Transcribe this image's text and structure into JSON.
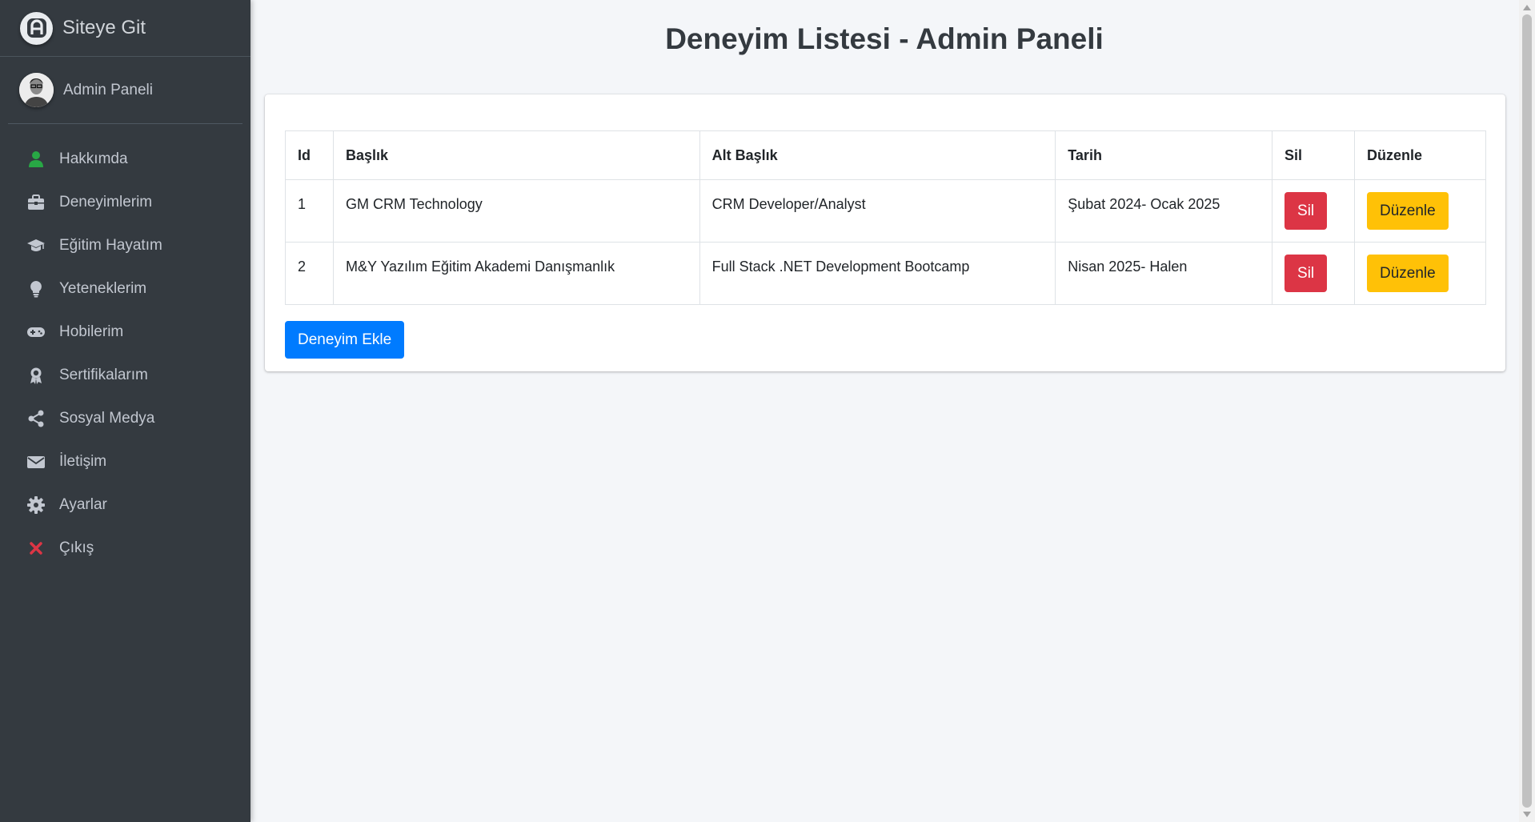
{
  "brand": {
    "logo_icon": "site-logo-icon",
    "text": "Siteye Git"
  },
  "user": {
    "avatar_icon": "user-avatar",
    "name": "Admin Paneli"
  },
  "sidebar": {
    "items": [
      {
        "label": "Hakkımda",
        "icon": "user-icon",
        "icon_color": "#28a745"
      },
      {
        "label": "Deneyimlerim",
        "icon": "briefcase-icon",
        "icon_color": "#c2c7d0"
      },
      {
        "label": "Eğitim Hayatım",
        "icon": "graduation-cap-icon",
        "icon_color": "#c2c7d0"
      },
      {
        "label": "Yeteneklerim",
        "icon": "lightbulb-icon",
        "icon_color": "#c2c7d0"
      },
      {
        "label": "Hobilerim",
        "icon": "gamepad-icon",
        "icon_color": "#c2c7d0"
      },
      {
        "label": "Sertifikalarım",
        "icon": "award-icon",
        "icon_color": "#c2c7d0"
      },
      {
        "label": "Sosyal Medya",
        "icon": "share-icon",
        "icon_color": "#c2c7d0"
      },
      {
        "label": "İletişim",
        "icon": "envelope-icon",
        "icon_color": "#c2c7d0"
      },
      {
        "label": "Ayarlar",
        "icon": "gear-icon",
        "icon_color": "#c2c7d0"
      },
      {
        "label": "Çıkış",
        "icon": "close-icon",
        "icon_color": "#dc3545"
      }
    ]
  },
  "main": {
    "title": "Deneyim Listesi - Admin Paneli",
    "table": {
      "headers": [
        "Id",
        "Başlık",
        "Alt Başlık",
        "Tarih",
        "Sil",
        "Düzenle"
      ],
      "rows": [
        {
          "id": "1",
          "title": "GM CRM Technology",
          "subtitle": "CRM Developer/Analyst",
          "date": "Şubat 2024- Ocak 2025",
          "delete_label": "Sil",
          "edit_label": "Düzenle"
        },
        {
          "id": "2",
          "title": "M&Y Yazılım Eğitim Akademi Danışmanlık",
          "subtitle": "Full Stack .NET Development Bootcamp",
          "date": "Nisan 2025- Halen",
          "delete_label": "Sil",
          "edit_label": "Düzenle"
        }
      ]
    },
    "add_button_label": "Deneyim Ekle"
  },
  "colors": {
    "sidebar_bg": "#343a40",
    "page_bg": "#f4f6f9",
    "danger": "#dc3545",
    "warning": "#ffc107",
    "primary": "#007bff"
  }
}
